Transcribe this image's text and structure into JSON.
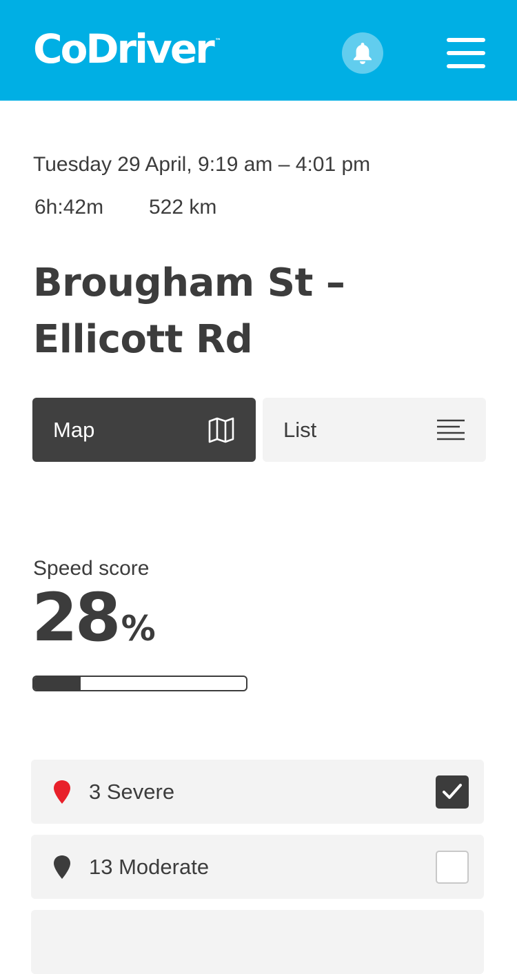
{
  "header": {
    "logo": "CoDriver",
    "logo_mark": "™",
    "bell_icon": "bell-icon",
    "menu_icon": "hamburger-menu-icon",
    "background": "#00afe4"
  },
  "trip": {
    "date": "Tuesday 29 April,  9:19 am – 4:01 pm",
    "duration": "6h:42m",
    "distance": "522 km",
    "title": "Brougham St – Ellicott Rd"
  },
  "view_toggle": {
    "map_label": "Map",
    "map_icon": "map-icon",
    "list_label": "List",
    "list_icon": "list-lines-icon",
    "selected": "Map"
  },
  "speed_score": {
    "label": "Speed score",
    "value": "28",
    "unit": "%",
    "progress_fraction": 0.22
  },
  "filters": [
    {
      "label": "3 Severe",
      "pin_color": "#e8202a",
      "checked": true
    },
    {
      "label": "13 Moderate",
      "pin_color": "#3c3c3c",
      "checked": false
    }
  ]
}
